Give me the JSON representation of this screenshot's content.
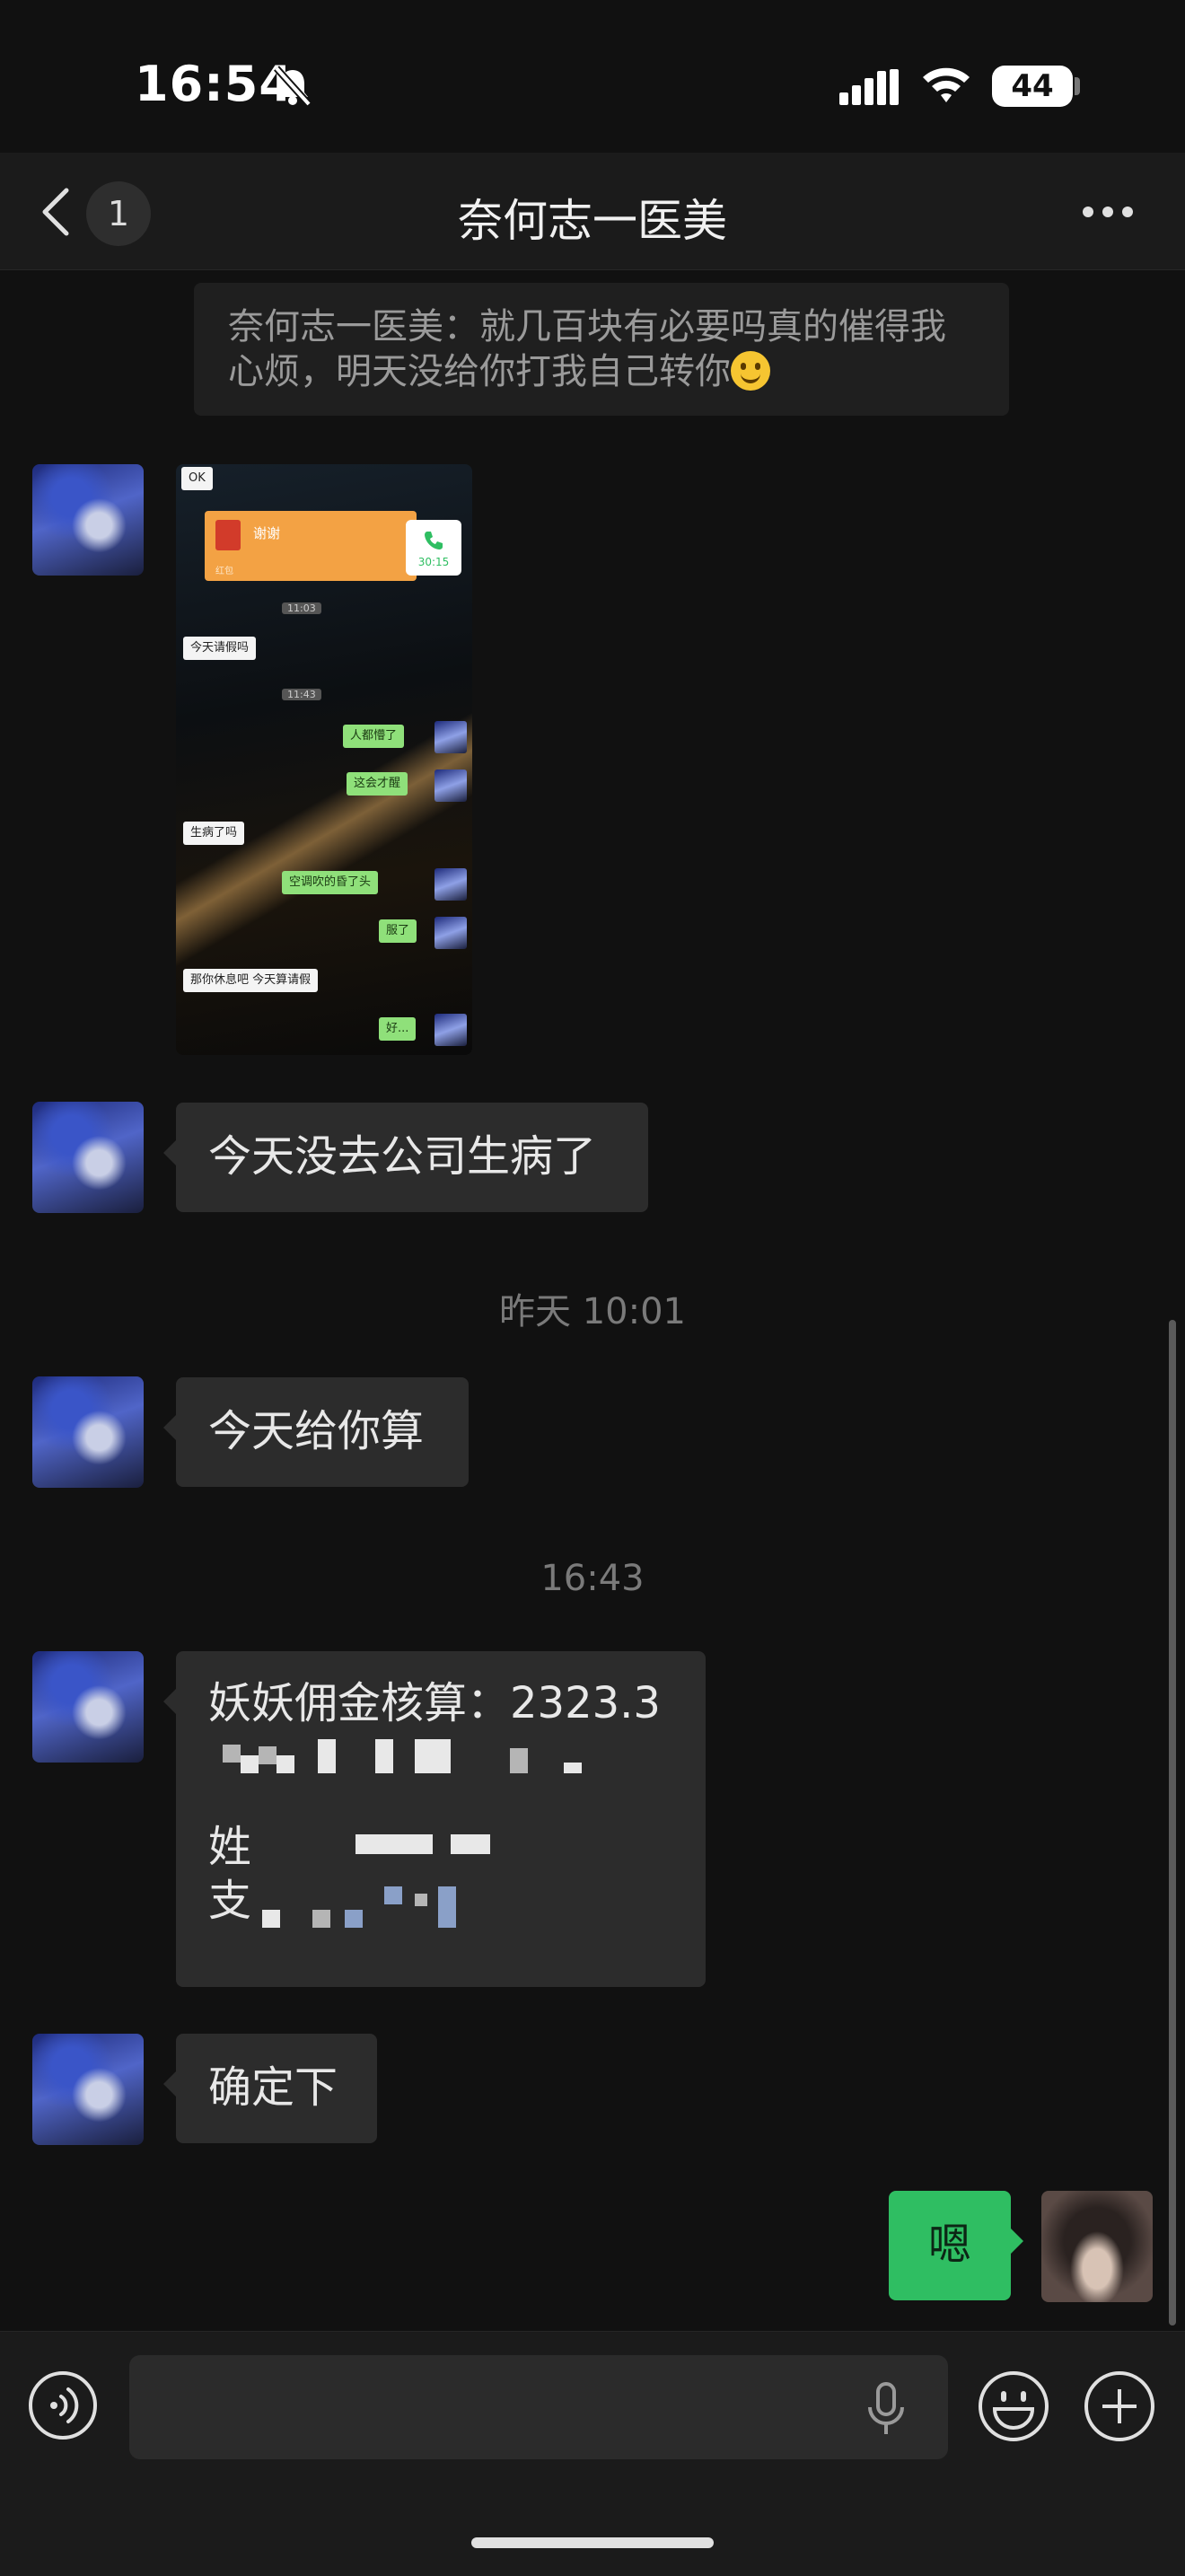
{
  "status_bar": {
    "time": "16:54",
    "battery": "44"
  },
  "nav": {
    "back_count": "1",
    "title": "奈何志一医美"
  },
  "system_message": {
    "text": "奈何志一医美：就几百块有必要吗真的催得我心烦，明天没给你打我自己转你"
  },
  "image_message": {
    "bubbles": [
      {
        "text": "OK",
        "side": "left"
      },
      {
        "text": "谢谢",
        "side": "left"
      },
      {
        "text": "30:15",
        "side": "right"
      },
      {
        "text": "11:03",
        "side": "time"
      },
      {
        "text": "今天请假吗",
        "side": "left"
      },
      {
        "text": "11:43",
        "side": "time"
      },
      {
        "text": "人都懵了",
        "side": "right"
      },
      {
        "text": "这会才醒",
        "side": "right"
      },
      {
        "text": "生病了吗",
        "side": "left"
      },
      {
        "text": "空调吹的昏了头",
        "side": "right"
      },
      {
        "text": "服了",
        "side": "right"
      },
      {
        "text": "那你休息吧 今天算请假",
        "side": "left"
      },
      {
        "text": "好...",
        "side": "right"
      }
    ],
    "redpacket_sub": "红包"
  },
  "messages": [
    {
      "text": "今天没去公司生病了"
    },
    {
      "timestamp": "昨天 10:01"
    },
    {
      "text": "今天给你算"
    },
    {
      "timestamp": "16:43"
    },
    {
      "line1": "妖妖佣金核算：2323.3",
      "line3": "姓名",
      "line4": "支付宝"
    },
    {
      "text": "确定下"
    },
    {
      "text": "嗯"
    }
  ],
  "input": {
    "placeholder": ""
  },
  "colors": {
    "accent": "#2fbe62",
    "background": "#111111",
    "bubble": "#2c2c2c"
  }
}
